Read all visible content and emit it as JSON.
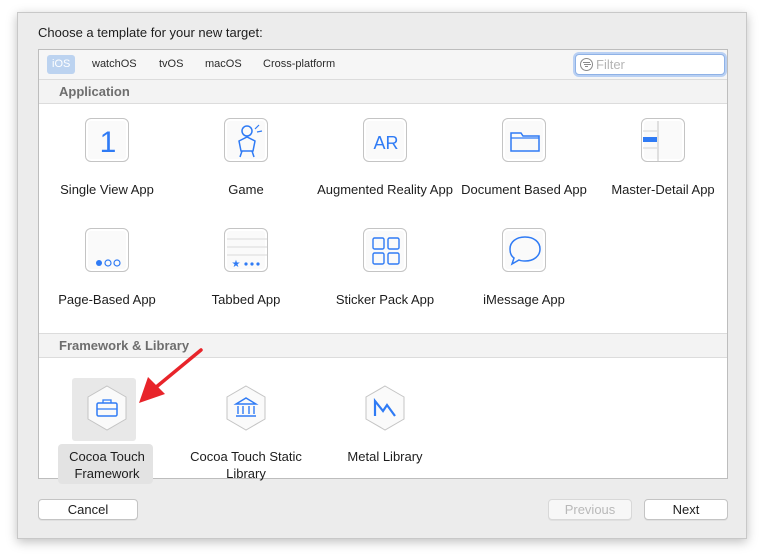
{
  "dialog": {
    "prompt": "Choose a template for your new target:"
  },
  "tabs": [
    {
      "label": "iOS",
      "active": true
    },
    {
      "label": "watchOS",
      "active": false
    },
    {
      "label": "tvOS",
      "active": false
    },
    {
      "label": "macOS",
      "active": false
    },
    {
      "label": "Cross-platform",
      "active": false
    }
  ],
  "filter": {
    "placeholder": "Filter",
    "value": ""
  },
  "sections": {
    "application": {
      "title": "Application",
      "items": [
        {
          "label": "Single View App",
          "icon": "number-one-icon"
        },
        {
          "label": "Game",
          "icon": "game-character-icon"
        },
        {
          "label": "Augmented Reality App",
          "icon": "ar-icon"
        },
        {
          "label": "Document Based App",
          "icon": "folder-icon"
        },
        {
          "label": "Master-Detail App",
          "icon": "master-detail-icon"
        },
        {
          "label": "Page-Based App",
          "icon": "page-dots-icon"
        },
        {
          "label": "Tabbed App",
          "icon": "tab-bar-icon"
        },
        {
          "label": "Sticker Pack App",
          "icon": "sticker-grid-icon"
        },
        {
          "label": "iMessage App",
          "icon": "speech-bubble-icon"
        }
      ]
    },
    "framework": {
      "title": "Framework & Library",
      "items": [
        {
          "label": "Cocoa Touch Framework",
          "icon": "toolbox-icon",
          "selected": true
        },
        {
          "label": "Cocoa Touch Static Library",
          "icon": "library-building-icon",
          "selected": false
        },
        {
          "label": "Metal Library",
          "icon": "metal-icon",
          "selected": false
        }
      ]
    }
  },
  "annotation": {
    "arrow_color": "#e8242a",
    "icon": "red-arrow-icon"
  },
  "buttons": {
    "cancel": "Cancel",
    "previous": "Previous",
    "next": "Next"
  },
  "colors": {
    "accent": "#2f7bf5",
    "tab_active_bg": "#bcd3f0",
    "filter_focus": "#8fb2e6"
  }
}
